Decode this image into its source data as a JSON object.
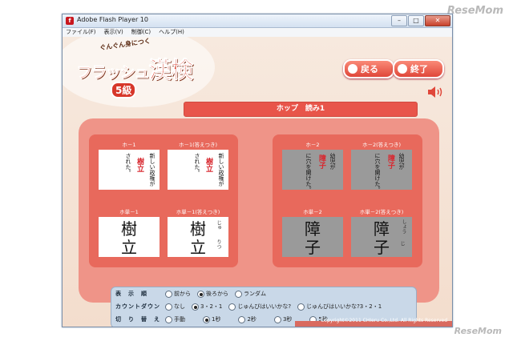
{
  "watermark": {
    "top": "ReseMom",
    "bottom": "ReseMom"
  },
  "window": {
    "title": "Adobe Flash Player 10",
    "app_icon": "flash-icon"
  },
  "menubar": [
    "ファイル(F)",
    "表示(V)",
    "制御(C)",
    "ヘルプ(H)"
  ],
  "logo": {
    "subtitle": "ぐんぐん身につく",
    "title_kana": "フラッシュ",
    "title_kanji": "漢検",
    "grade": "5級"
  },
  "buttons": {
    "back": "戻る",
    "end": "終了"
  },
  "banner": "ホップ　読み1",
  "left_cards": {
    "c1": {
      "label": "ホ－1",
      "pre": "新しい政権が",
      "hl": "樹立",
      "post": "された。"
    },
    "c2": {
      "label": "ホ－1(答えつき)",
      "pre": "新しい政権が",
      "hl": "樹立",
      "post": "された。"
    },
    "c3": {
      "label": "ホ単－1",
      "k1": "樹",
      "k2": "立"
    },
    "c4": {
      "label": "ホ単－1(答えつき)",
      "k1": "樹",
      "k2": "立",
      "r1": "じゅ",
      "r2": "りつ"
    }
  },
  "right_cards": {
    "c1": {
      "label": "ホ－2",
      "pre": "幼児が",
      "hl": "障子",
      "post": "に穴を開けた。"
    },
    "c2": {
      "label": "ホ－2(答えつき)",
      "pre": "幼児が",
      "hl": "障子",
      "post": "に穴を開けた。"
    },
    "c3": {
      "label": "ホ単－2",
      "k1": "障",
      "k2": "子"
    },
    "c4": {
      "label": "ホ単－2(答えつき)",
      "k1": "障",
      "k2": "子",
      "r1": "しょう",
      "r2": "じ"
    }
  },
  "controls": {
    "order": {
      "label": "表　示　順",
      "options": [
        "前から",
        "後ろから",
        "ランダム"
      ],
      "selected": 1
    },
    "countdown": {
      "label": "カウントダウン",
      "options": [
        "なし",
        "3・2・1",
        "じゅんびはいいかな?",
        "じゅんびはいいかな?3・2・1"
      ],
      "selected": 1
    },
    "switch": {
      "label": "切　り　替　え",
      "options": [
        "手動",
        "1秒",
        "2秒",
        "3秒",
        "5秒"
      ],
      "selected": 1
    }
  },
  "copyright": "Copyright©2011 CHIeru Co.,Ltd. All Rights Reserved",
  "colors": {
    "accent": "#e8554a",
    "panel": "#e8695c",
    "background": "#f4e3d7"
  }
}
